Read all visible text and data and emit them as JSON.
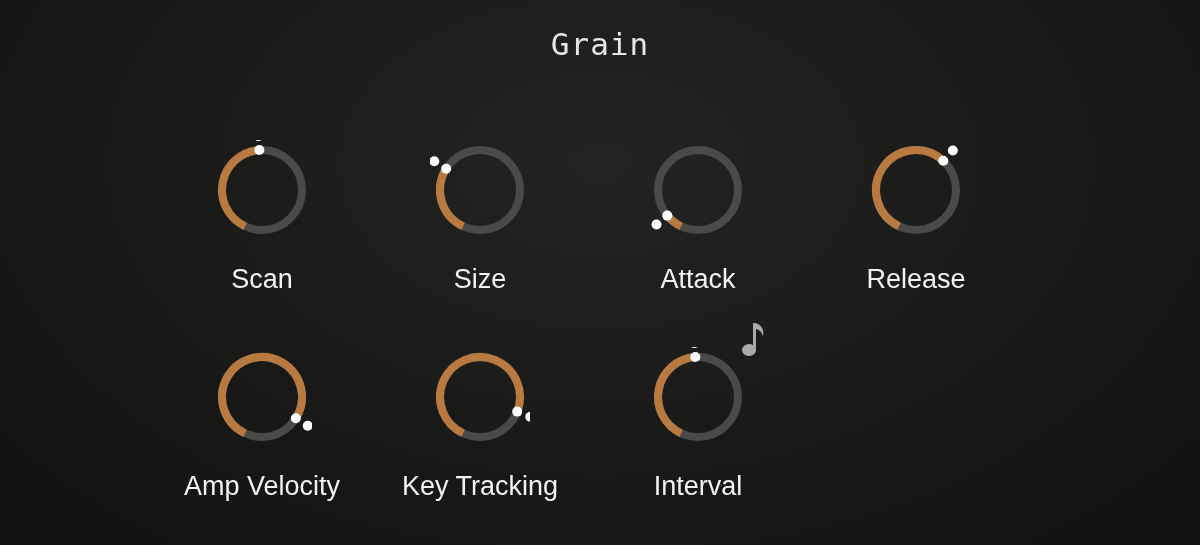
{
  "title": "Grain",
  "knobs": [
    {
      "label": "Scan",
      "tempo_sync": false
    },
    {
      "label": "Size",
      "tempo_sync": false
    },
    {
      "label": "Attack",
      "tempo_sync": false
    },
    {
      "label": "Release",
      "tempo_sync": false
    },
    {
      "label": "Amp Velocity",
      "tempo_sync": false
    },
    {
      "label": "Key Tracking",
      "tempo_sync": false
    },
    {
      "label": "Interval",
      "tempo_sync": true
    }
  ]
}
